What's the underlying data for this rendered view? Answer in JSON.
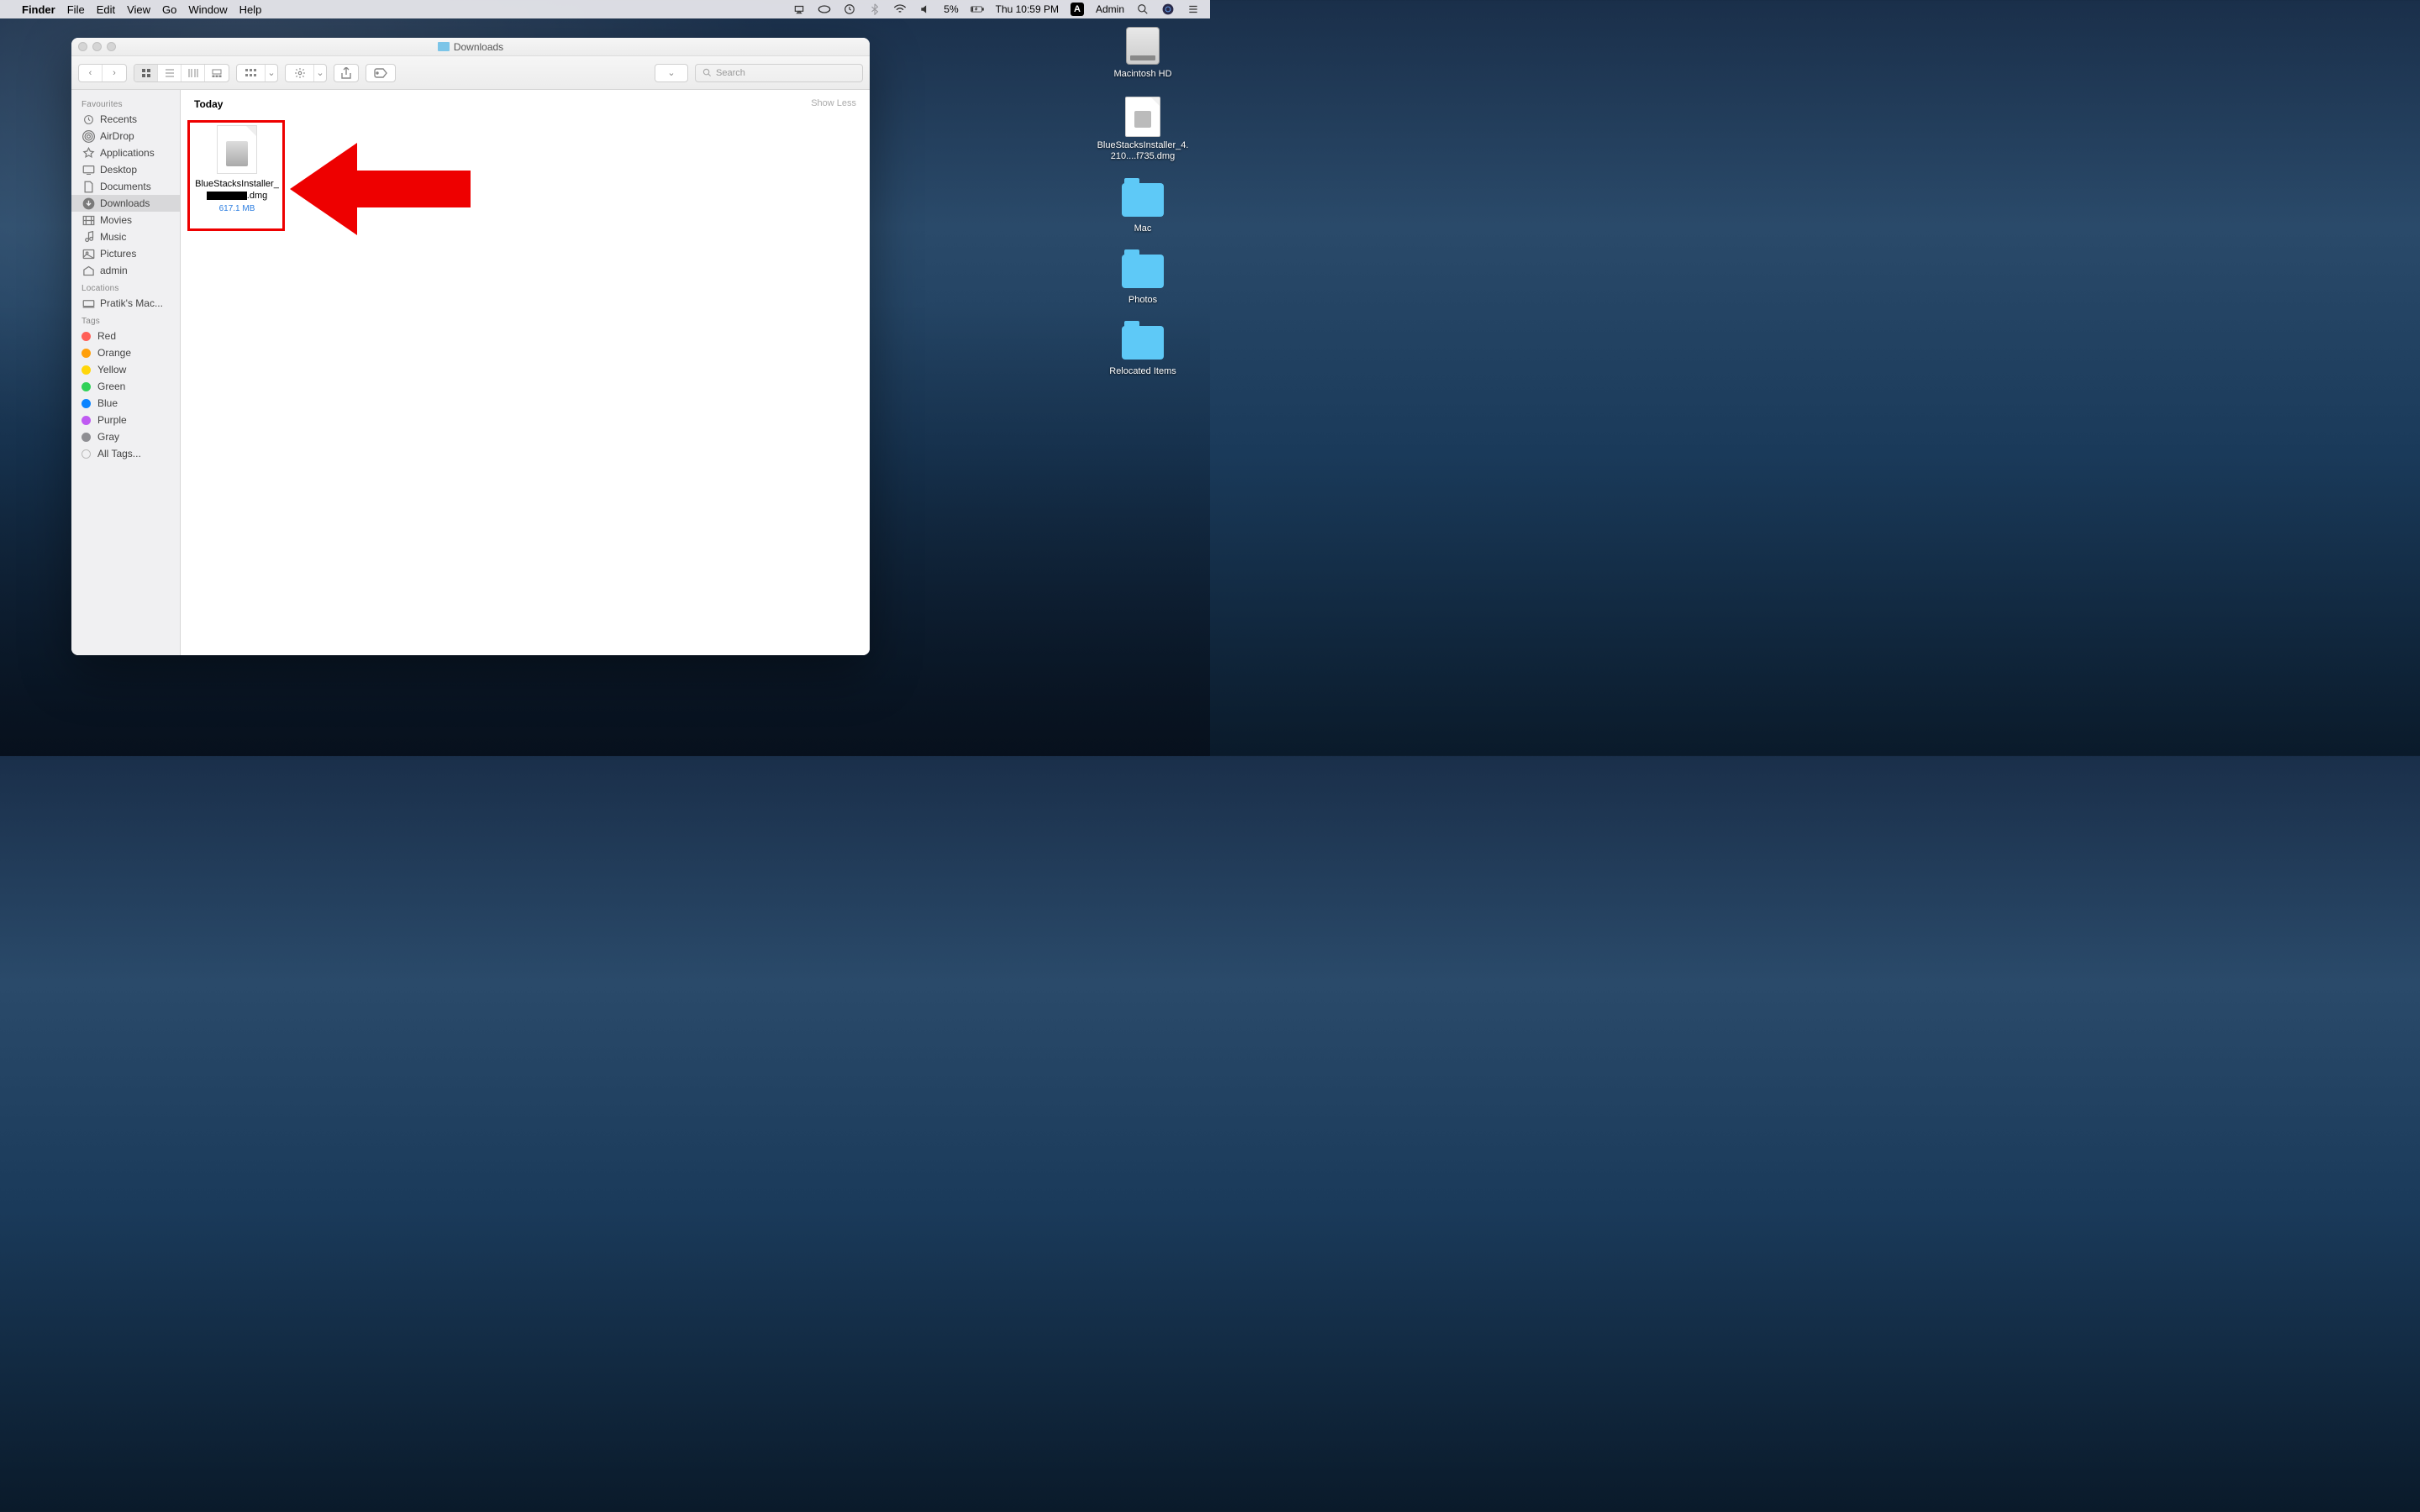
{
  "menubar": {
    "app": "Finder",
    "items": [
      "File",
      "Edit",
      "View",
      "Go",
      "Window",
      "Help"
    ],
    "right": {
      "battery": "5%",
      "datetime": "Thu 10:59 PM",
      "admin_initial": "A",
      "user": "Admin"
    }
  },
  "desktop": {
    "items": [
      {
        "label": "Macintosh HD",
        "kind": "hd"
      },
      {
        "label": "BlueStacksInstaller_4.210....f735.dmg",
        "kind": "dmg"
      },
      {
        "label": "Mac",
        "kind": "folder"
      },
      {
        "label": "Photos",
        "kind": "folder"
      },
      {
        "label": "Relocated Items",
        "kind": "folder"
      }
    ]
  },
  "finder": {
    "title": "Downloads",
    "search_placeholder": "Search",
    "sidebar": {
      "favourites_heading": "Favourites",
      "favourites": [
        "Recents",
        "AirDrop",
        "Applications",
        "Desktop",
        "Documents",
        "Downloads",
        "Movies",
        "Music",
        "Pictures",
        "admin"
      ],
      "selected_favourite": "Downloads",
      "locations_heading": "Locations",
      "locations": [
        "Pratik's Mac..."
      ],
      "tags_heading": "Tags",
      "tags": [
        {
          "label": "Red",
          "color": "#ff5f57"
        },
        {
          "label": "Orange",
          "color": "#ff9f0a"
        },
        {
          "label": "Yellow",
          "color": "#ffd60a"
        },
        {
          "label": "Green",
          "color": "#30d158"
        },
        {
          "label": "Blue",
          "color": "#0a84ff"
        },
        {
          "label": "Purple",
          "color": "#bf5af2"
        },
        {
          "label": "Gray",
          "color": "#8e8e93"
        },
        {
          "label": "All Tags...",
          "color": "transparent"
        }
      ]
    },
    "content": {
      "section": "Today",
      "show_less": "Show Less",
      "files": [
        {
          "name_prefix": "BlueStacksInstaller_",
          "name_suffix": ".dmg",
          "size": "617.1 MB"
        }
      ]
    }
  }
}
